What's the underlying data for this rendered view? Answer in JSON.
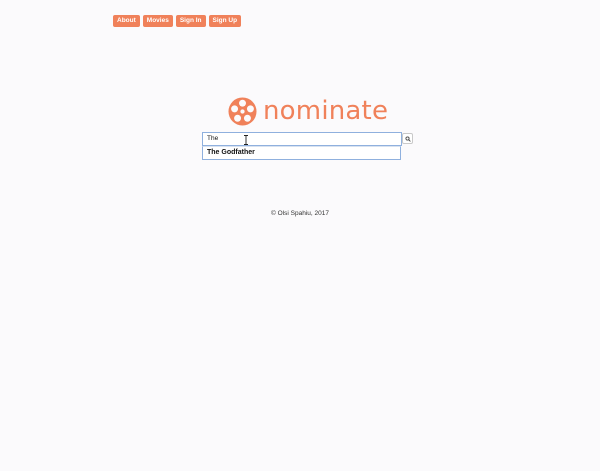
{
  "nav": {
    "items": [
      {
        "label": "About"
      },
      {
        "label": "Movies"
      },
      {
        "label": "Sign In"
      },
      {
        "label": "Sign Up"
      }
    ]
  },
  "logo": {
    "text": "nominate",
    "icon": "film-reel-icon",
    "color": "#f0815a"
  },
  "search": {
    "value": "The",
    "button_icon": "search-icon"
  },
  "suggestions": [
    {
      "label": "The Godfather"
    }
  ],
  "footer": {
    "text": "© Olsi Spahiu, 2017"
  },
  "colors": {
    "accent": "#f0815a",
    "input_border": "#8fb0de",
    "background": "#fbfafc"
  }
}
